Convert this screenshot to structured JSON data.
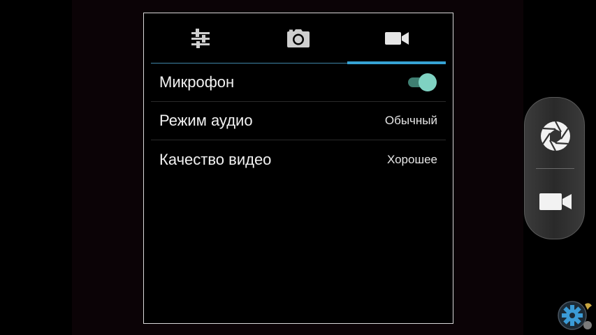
{
  "tabs": [
    {
      "icon": "sliders-icon",
      "selected": false
    },
    {
      "icon": "camera-icon",
      "selected": false
    },
    {
      "icon": "video-camera-icon",
      "selected": true
    }
  ],
  "settings": {
    "microphone": {
      "label": "Микрофон",
      "enabled": true
    },
    "audio_mode": {
      "label": "Режим аудио",
      "value": "Обычный"
    },
    "video_quality": {
      "label": "Качество видео",
      "value": "Хорошее"
    }
  },
  "colors": {
    "accent": "#36a3d4",
    "toggle_on": "#7fd2c2"
  },
  "side_panel": {
    "buttons": [
      {
        "icon": "shutter-icon"
      },
      {
        "icon": "video-camera-icon"
      }
    ]
  }
}
